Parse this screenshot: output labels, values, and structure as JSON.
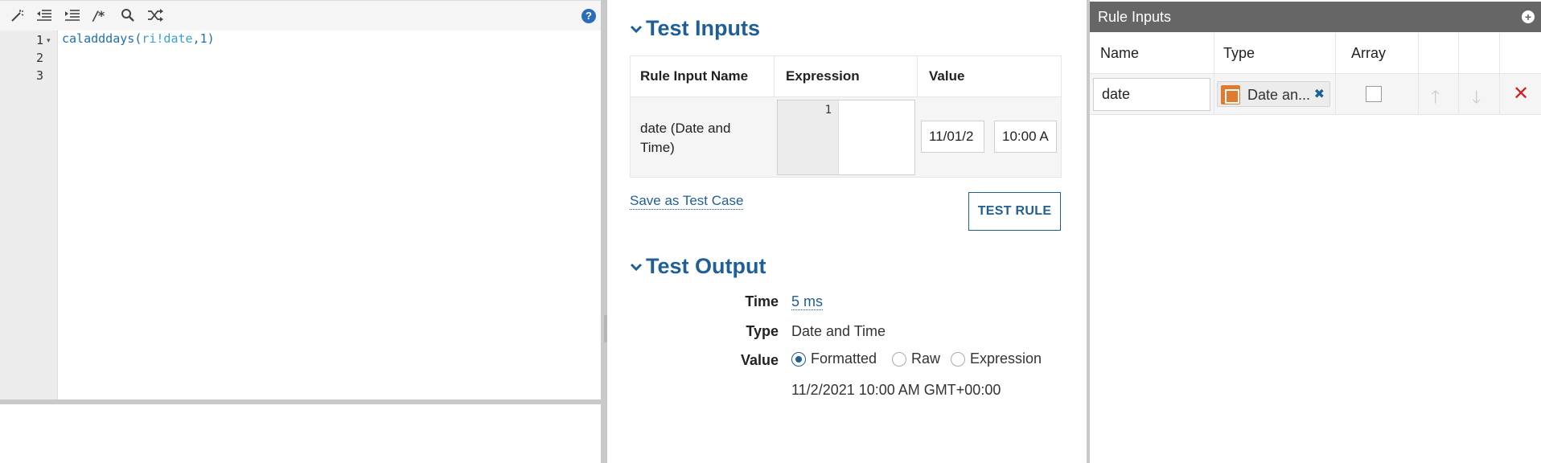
{
  "editor": {
    "toolbar": {
      "icons": [
        "magic-wand-icon",
        "outdent-icon",
        "indent-icon",
        "comment-icon",
        "search-icon",
        "shuffle-icon",
        "help-icon"
      ],
      "comment_glyph": "/*",
      "help_glyph": "?"
    },
    "line_numbers": [
      "1",
      "2",
      "3"
    ],
    "code": {
      "fn": "caladddays",
      "open": "(",
      "ri": "ri!date",
      "rest": ",1)"
    }
  },
  "test_inputs": {
    "title": "Test Inputs",
    "columns": [
      "Rule Input Name",
      "Expression",
      "Value"
    ],
    "row": {
      "name": "date (Date and Time)",
      "expr_line": "1",
      "date_value": "11/01/2",
      "time_value": "10:00 A"
    },
    "save_link": "Save as Test Case",
    "test_button": "TEST RULE"
  },
  "test_output": {
    "title": "Test Output",
    "time_label": "Time",
    "time_value": "5 ms",
    "type_label": "Type",
    "type_value": "Date and Time",
    "value_label": "Value",
    "radio_options": [
      "Formatted",
      "Raw",
      "Expression"
    ],
    "selected_radio": "Formatted",
    "result": "11/2/2021 10:00 AM GMT+00:00"
  },
  "rule_inputs": {
    "title": "Rule Inputs",
    "columns": [
      "Name",
      "Type",
      "Array"
    ],
    "row": {
      "name": "date",
      "type": "Date an...",
      "array": false
    }
  },
  "colors": {
    "accent": "#1f5f97",
    "header_bg": "#666666",
    "type_icon": "#e07a2e",
    "delete": "#cc2222"
  }
}
